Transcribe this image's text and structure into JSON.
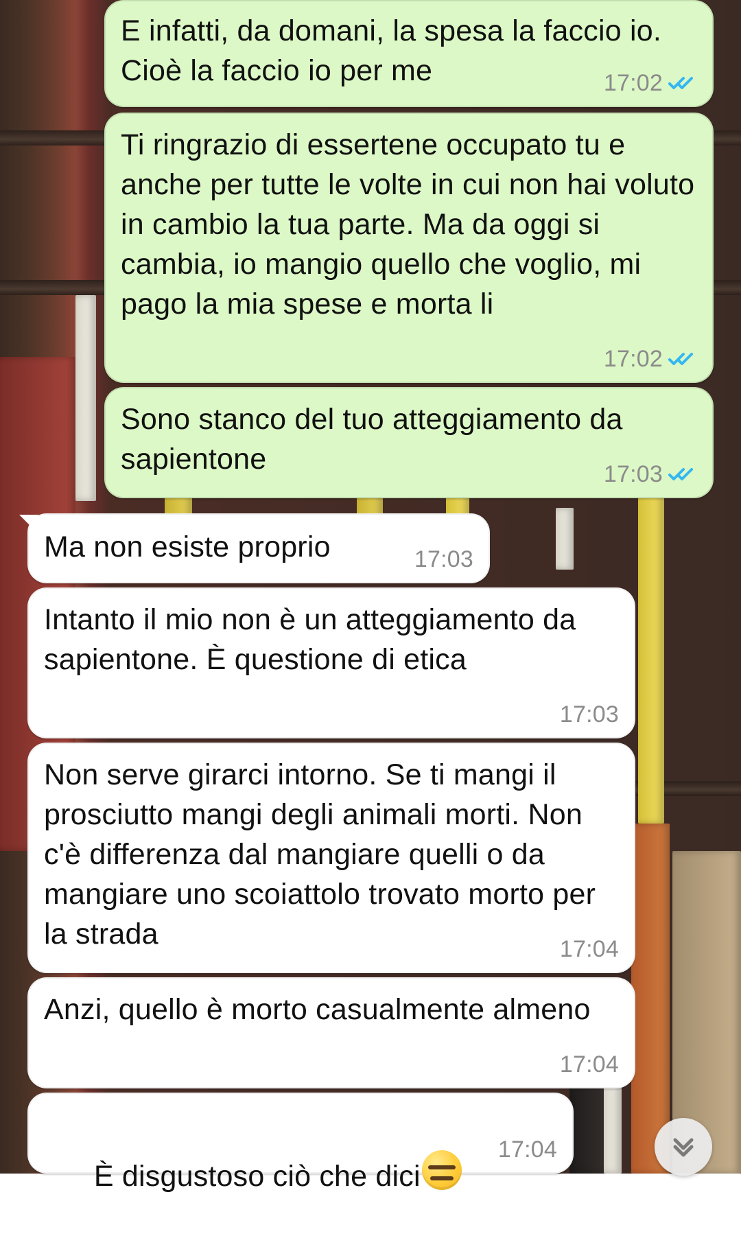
{
  "conversation": {
    "messages": [
      {
        "direction": "outgoing",
        "text": "E infatti, da domani, la spesa la faccio io. Cioè la faccio io per me",
        "time": "17:02",
        "status": "read"
      },
      {
        "direction": "outgoing",
        "text": "Ti ringrazio di essertene occupato tu e anche per tutte le volte in cui non hai voluto in cambio la tua parte. Ma da oggi si cambia, io mangio quello che voglio, mi pago la mia spese e morta li",
        "time": "17:02",
        "status": "read"
      },
      {
        "direction": "outgoing",
        "text": "Sono stanco del tuo atteggiamento da sapientone",
        "time": "17:03",
        "status": "read"
      },
      {
        "direction": "incoming",
        "text": "Ma non esiste proprio",
        "time": "17:03"
      },
      {
        "direction": "incoming",
        "text": "Intanto il mio non è un atteggiamento da sapientone. È questione di etica",
        "time": "17:03"
      },
      {
        "direction": "incoming",
        "text": "Non serve girarci intorno. Se ti mangi il prosciutto mangi degli animali morti. Non c'è differenza dal mangiare quelli o da mangiare uno scoiattolo trovato morto per la strada",
        "time": "17:04"
      },
      {
        "direction": "incoming",
        "text": "Anzi, quello è morto casualmente almeno",
        "time": "17:04"
      },
      {
        "direction": "incoming",
        "text": "È disgustoso ciò che dici",
        "emoji": "expressionless-face-emoji",
        "time": "17:04"
      }
    ]
  },
  "icons": {
    "read_receipt": "double-check-icon",
    "scroll_down": "chevron-double-down-icon"
  },
  "colors": {
    "outgoing_bubble": "#dcf8c6",
    "incoming_bubble": "#ffffff",
    "read_tick": "#34b7f1",
    "timestamp": "#8b8b8b"
  }
}
